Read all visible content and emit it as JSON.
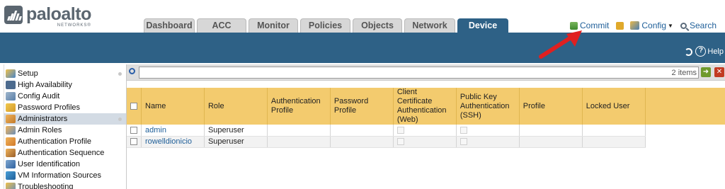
{
  "brand": {
    "name": "paloalto",
    "subtitle": "NETWORKS®"
  },
  "tabs": [
    {
      "label": "Dashboard",
      "active": false
    },
    {
      "label": "ACC",
      "active": false
    },
    {
      "label": "Monitor",
      "active": false
    },
    {
      "label": "Policies",
      "active": false
    },
    {
      "label": "Objects",
      "active": false
    },
    {
      "label": "Network",
      "active": false
    },
    {
      "label": "Device",
      "active": true
    }
  ],
  "top_actions": {
    "commit": "Commit",
    "config": "Config",
    "search": "Search"
  },
  "toolbar": {
    "help": "Help"
  },
  "sidebar": {
    "items": [
      {
        "label": "Setup",
        "icon": "setup-icon",
        "selected": false
      },
      {
        "label": "High Availability",
        "icon": "high-availability-icon",
        "selected": false
      },
      {
        "label": "Config Audit",
        "icon": "config-audit-icon",
        "selected": false
      },
      {
        "label": "Password Profiles",
        "icon": "password-profiles-icon",
        "selected": false
      },
      {
        "label": "Administrators",
        "icon": "administrators-icon",
        "selected": true
      },
      {
        "label": "Admin Roles",
        "icon": "admin-roles-icon",
        "selected": false
      },
      {
        "label": "Authentication Profile",
        "icon": "authentication-profile-icon",
        "selected": false
      },
      {
        "label": "Authentication Sequence",
        "icon": "authentication-sequence-icon",
        "selected": false
      },
      {
        "label": "User Identification",
        "icon": "user-identification-icon",
        "selected": false
      },
      {
        "label": "VM Information Sources",
        "icon": "vm-information-sources-icon",
        "selected": false
      },
      {
        "label": "Troubleshooting",
        "icon": "troubleshooting-icon",
        "selected": false
      }
    ]
  },
  "filter": {
    "value": "",
    "items_count": "2 items"
  },
  "table": {
    "columns": [
      "Name",
      "Role",
      "Authentication Profile",
      "Password Profile",
      "Client Certificate Authentication (Web)",
      "Public Key Authentication (SSH)",
      "Profile",
      "Locked User"
    ],
    "rows": [
      {
        "name": "admin",
        "role": "Superuser"
      },
      {
        "name": "rowelldionicio",
        "role": "Superuser"
      }
    ]
  },
  "colors": {
    "header_blue": "#2e6186",
    "table_header": "#f3cb6e",
    "link": "#1f5f99",
    "annotation_arrow": "#e02020"
  }
}
